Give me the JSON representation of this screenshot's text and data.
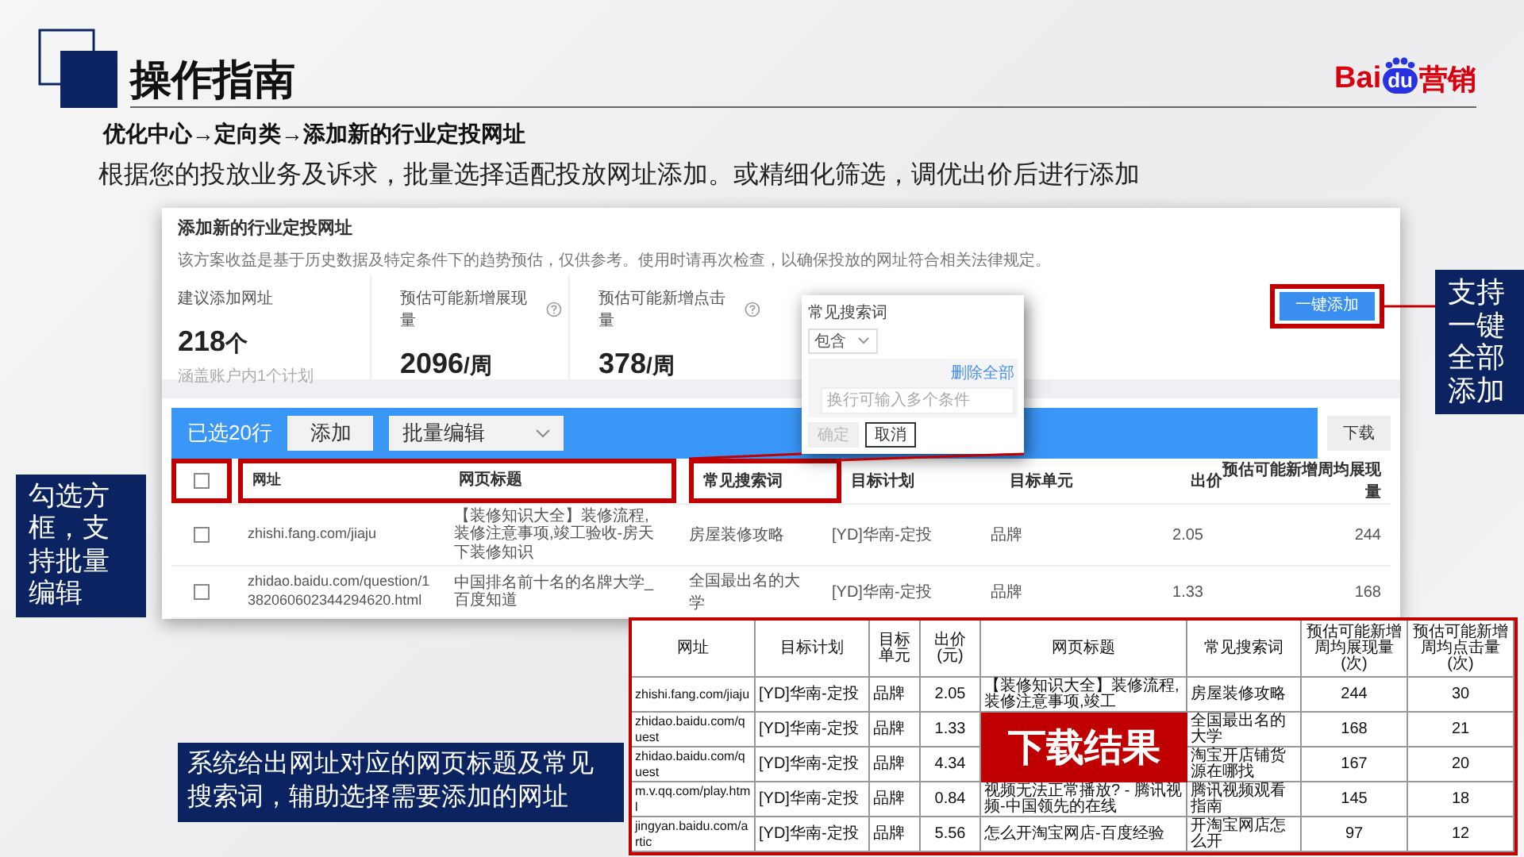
{
  "header": {
    "title": "操作指南",
    "breadcrumb": "优化中心→定向类→添加新的行业定投网址",
    "description": "根据您的投放业务及诉求，批量选择适配投放网址添加。或精细化筛选，调优出价后进行添加"
  },
  "logo": {
    "left": "Bai",
    "badge": "du",
    "right": "营销"
  },
  "panel": {
    "title": "添加新的行业定投网址",
    "notice": "该方案收益是基于历史数据及特定条件下的趋势预估，仅供参考。使用时请再次检查，以确保投放的网址符合相关法律规定。",
    "add_all_button": "一键添加",
    "stats": [
      {
        "label": "建议添加网址",
        "value": "218",
        "unit": "个",
        "note": "涵盖账户内1个计划",
        "help": false
      },
      {
        "label": "预估可能新增展现量",
        "value": "2096",
        "unit": "/周",
        "help": true
      },
      {
        "label": "预估可能新增点击量",
        "value": "378",
        "unit": "/周",
        "help": true
      }
    ],
    "toolbar": {
      "selected_count": "已选20行",
      "add_button": "添加",
      "batch_edit": "批量编辑",
      "download_button": "下载"
    },
    "table": {
      "header_checked": false,
      "columns": [
        "网址",
        "网页标题",
        "常见搜索词",
        "目标计划",
        "目标单元",
        "出价",
        "预估可能新增周均展现量"
      ],
      "rows": [
        {
          "checked": false,
          "cells": [
            "zhishi.fang.com/jiaju",
            "【装修知识大全】装修流程,装修注意事项,竣工验收-房天下装修知识",
            "房屋装修攻略",
            "[YD]华南-定投",
            "品牌",
            "2.05",
            "244"
          ]
        },
        {
          "checked": false,
          "cells": [
            "zhidao.baidu.com/question/1382060602344294620.html",
            "中国排名前十名的名牌大学_百度知道",
            "全国最出名的大学",
            "[YD]华南-定投",
            "品牌",
            "1.33",
            "168"
          ]
        }
      ]
    }
  },
  "popup": {
    "title": "常见搜索词",
    "match_select": "包含",
    "clear_all": "删除全部",
    "placeholder": "换行可输入多个条件",
    "confirm": "确定",
    "confirm_disabled": true,
    "cancel": "取消"
  },
  "callout_add_all": "支持一键全部添加",
  "callout_checkbox": "勾选方框，支持批量编辑",
  "callout_columns": "系统给出网址对应的网页标题及常见搜索词，辅助选择需要添加的网址",
  "download": {
    "banner": "下载结果",
    "columns": [
      "网址",
      "目标计划",
      "目标单元",
      "出价(元)",
      "网页标题",
      "常见搜索词",
      "预估可能新增周均展现量(次)",
      "预估可能新增周均点击量(次)"
    ],
    "rows": [
      {
        "url": "zhishi.fang.com/jiaju",
        "plan": "[YD]华南-定投",
        "unit": "品牌",
        "bid": "2.05",
        "title": "【装修知识大全】装修流程,装修注意事项,竣工",
        "term": "房屋装修攻略",
        "impressions": "244",
        "clicks": "30"
      },
      {
        "url": "zhidao.baidu.com/quest",
        "plan": "[YD]华南-定投",
        "unit": "品牌",
        "bid": "1.33",
        "term": "全国最出名的大学",
        "impressions": "168",
        "clicks": "21"
      },
      {
        "url": "zhidao.baidu.com/quest",
        "plan": "[YD]华南-定投",
        "unit": "品牌",
        "bid": "4.34",
        "term": "淘宝开店铺货源在哪找",
        "impressions": "167",
        "clicks": "20"
      },
      {
        "url": "m.v.qq.com/play.html",
        "plan": "[YD]华南-定投",
        "unit": "品牌",
        "bid": "0.84",
        "title": "视频无法正常播放? - 腾讯视频-中国领先的在线",
        "term": "腾讯视频观看指南",
        "impressions": "145",
        "clicks": "18"
      },
      {
        "url": "jingyan.baidu.com/artic",
        "plan": "[YD]华南-定投",
        "unit": "品牌",
        "bid": "5.56",
        "title": "怎么开淘宝网店-百度经验",
        "term": "开淘宝网店怎么开",
        "impressions": "97",
        "clicks": "12"
      }
    ]
  }
}
